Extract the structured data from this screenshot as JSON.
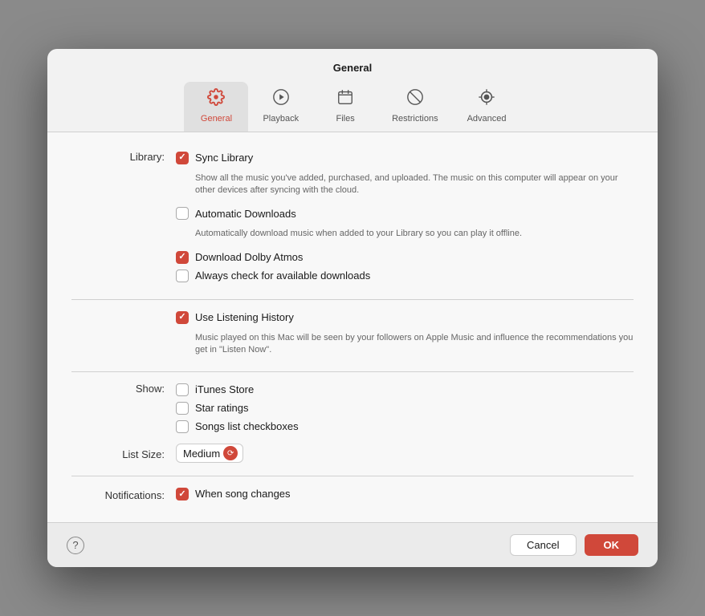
{
  "dialog": {
    "title": "General"
  },
  "tabs": [
    {
      "id": "general",
      "label": "General",
      "active": true
    },
    {
      "id": "playback",
      "label": "Playback",
      "active": false
    },
    {
      "id": "files",
      "label": "Files",
      "active": false
    },
    {
      "id": "restrictions",
      "label": "Restrictions",
      "active": false
    },
    {
      "id": "advanced",
      "label": "Advanced",
      "active": false
    }
  ],
  "sections": {
    "library_label": "Library:",
    "sync_library_label": "Sync Library",
    "sync_library_desc": "Show all the music you've added, purchased, and uploaded. The music on this computer will appear on your other devices after syncing with the cloud.",
    "auto_downloads_label": "Automatic Downloads",
    "auto_downloads_desc": "Automatically download music when added to your Library so you can play it offline.",
    "dolby_atmos_label": "Download Dolby Atmos",
    "check_downloads_label": "Always check for available downloads",
    "listening_history_label": "Use Listening History",
    "listening_history_desc": "Music played on this Mac will be seen by your followers on Apple Music and influence the recommendations you get in \"Listen Now\".",
    "show_label": "Show:",
    "itunes_store_label": "iTunes Store",
    "star_ratings_label": "Star ratings",
    "songs_list_label": "Songs list checkboxes",
    "list_size_label": "List Size:",
    "list_size_value": "Medium",
    "notifications_label": "Notifications:",
    "when_song_changes_label": "When song changes"
  },
  "checkboxes": {
    "sync_library": true,
    "auto_downloads": false,
    "dolby_atmos": true,
    "check_downloads": false,
    "listening_history": true,
    "itunes_store": false,
    "star_ratings": false,
    "songs_list": false,
    "when_song_changes": true
  },
  "footer": {
    "help_label": "?",
    "cancel_label": "Cancel",
    "ok_label": "OK"
  }
}
